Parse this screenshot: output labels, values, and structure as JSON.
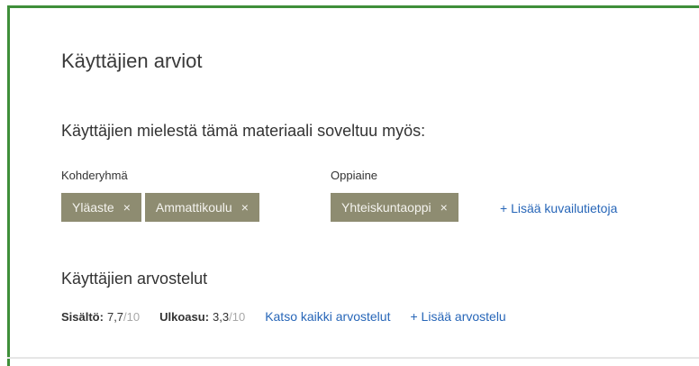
{
  "section_title": "Käyttäjien arviot",
  "suitable": {
    "heading": "Käyttäjien mielestä tämä materiaali soveltuu myös:",
    "target_group": {
      "label": "Kohderyhmä",
      "tags": [
        {
          "label": "Yläaste",
          "remove_icon": "×"
        },
        {
          "label": "Ammattikoulu",
          "remove_icon": "×"
        }
      ]
    },
    "subject": {
      "label": "Oppiaine",
      "tags": [
        {
          "label": "Yhteiskuntaoppi",
          "remove_icon": "×"
        }
      ]
    },
    "add_metadata_link": "+ Lisää kuvailutietoja"
  },
  "reviews": {
    "heading": "Käyttäjien arvostelut",
    "content_rating": {
      "label": "Sisältö:",
      "value": "7,7",
      "max": "/10"
    },
    "layout_rating": {
      "label": "Ulkoasu:",
      "value": "3,3",
      "max": "/10"
    },
    "see_all_link": "Katso kaikki arvostelut",
    "add_review_link": "+ Lisää arvostelu"
  },
  "colors": {
    "frame_border": "#3f8f3a",
    "tag_background": "#8e8c71",
    "link": "#2766b8"
  }
}
